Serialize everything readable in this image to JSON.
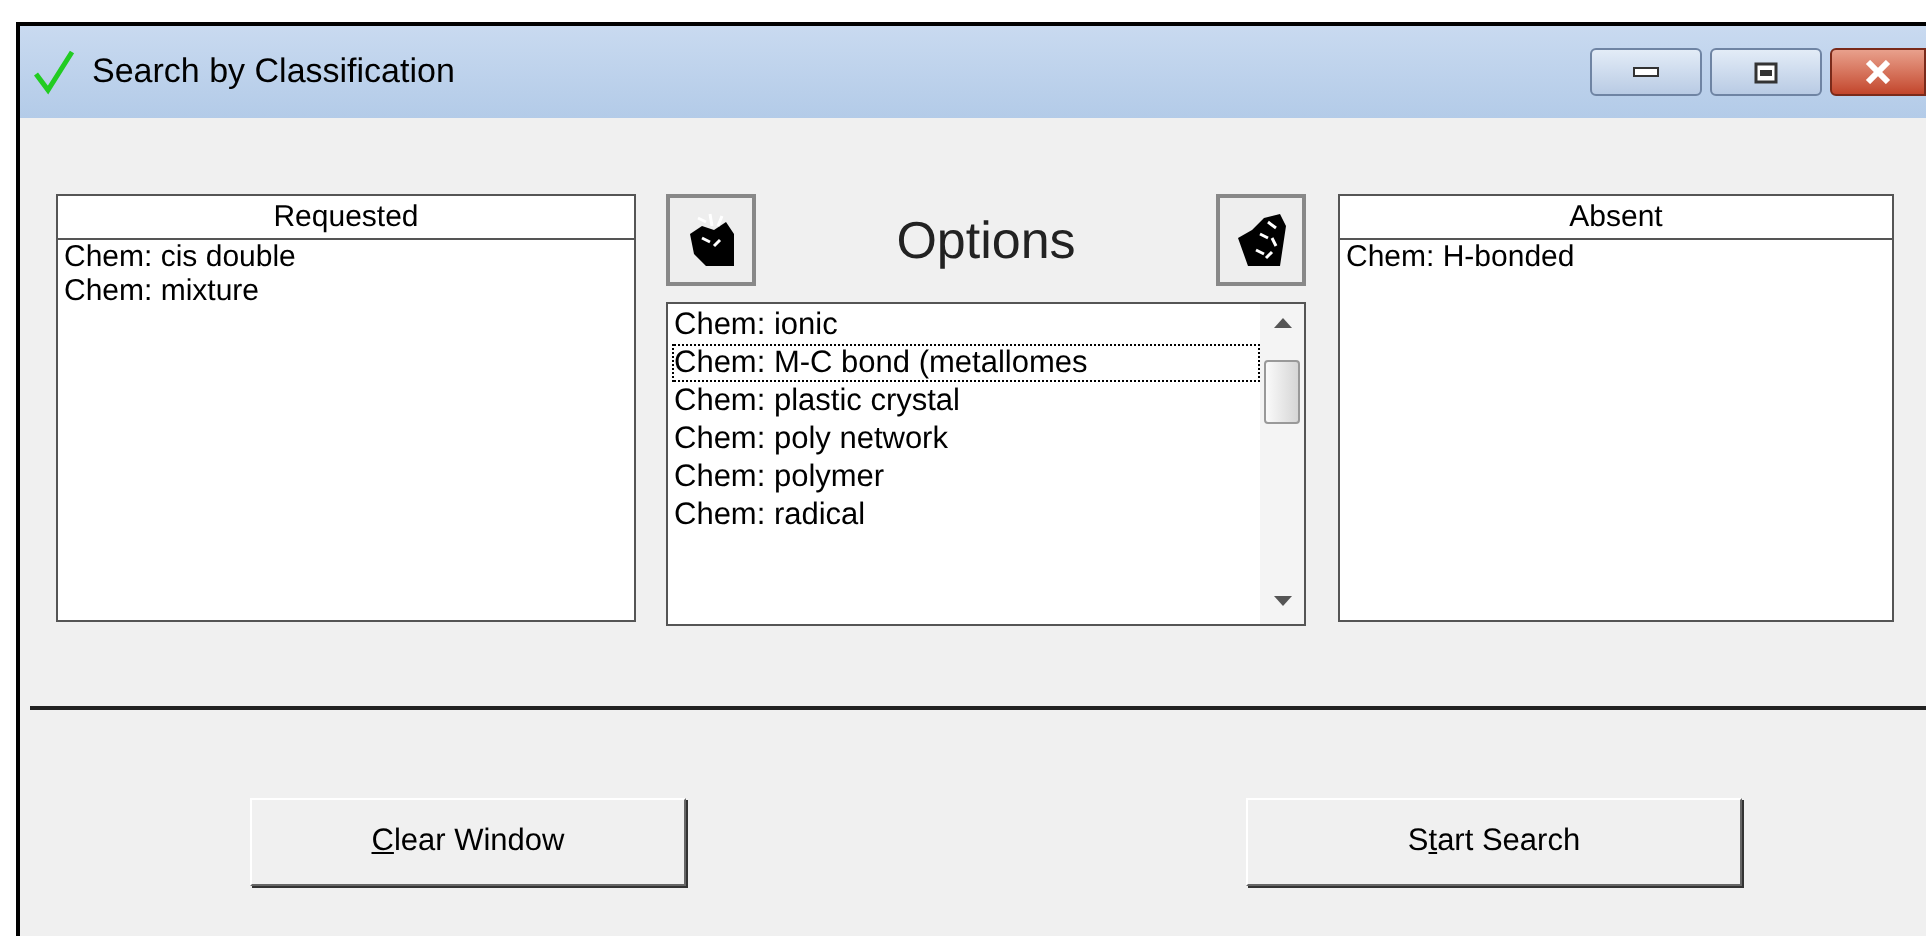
{
  "window": {
    "title": "Search by Classification"
  },
  "requested": {
    "header": "Requested",
    "items": [
      "Chem: cis double",
      "Chem: mixture"
    ]
  },
  "options": {
    "title": "Options",
    "items": [
      {
        "label": "Chem: ionic",
        "focused": false
      },
      {
        "label": "Chem: M-C bond (metallomes",
        "focused": true
      },
      {
        "label": "Chem: plastic crystal",
        "focused": false
      },
      {
        "label": "Chem: poly network",
        "focused": false
      },
      {
        "label": "Chem: polymer",
        "focused": false
      },
      {
        "label": "Chem: radical",
        "focused": false
      }
    ]
  },
  "absent": {
    "header": "Absent",
    "items": [
      "Chem: H-bonded"
    ]
  },
  "buttons": [
    {
      "key": "C",
      "after": "lear Window"
    },
    {
      "before": "S",
      "key": "t",
      "after": "art Search"
    }
  ]
}
